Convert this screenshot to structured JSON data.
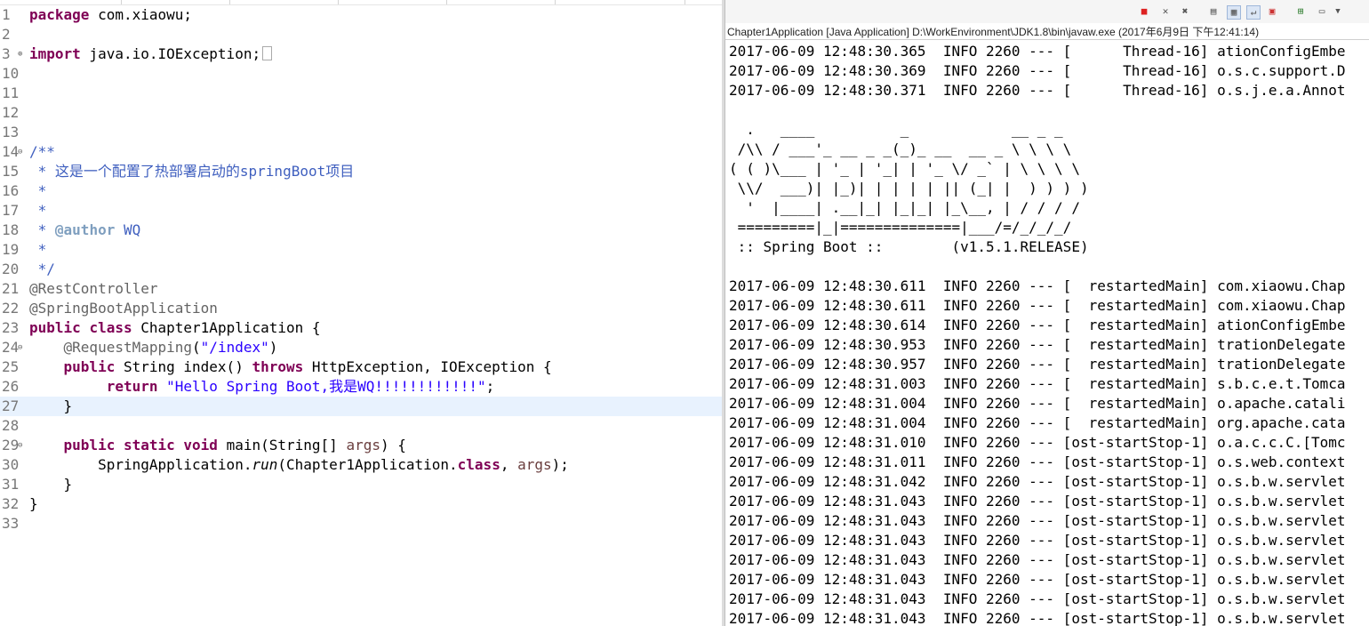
{
  "editor": {
    "lines": [
      {
        "num": "1",
        "parts": [
          {
            "t": "package",
            "c": "kw"
          },
          {
            "t": " com.xiaowu;"
          }
        ]
      },
      {
        "num": "2",
        "parts": []
      },
      {
        "num": "3",
        "fold": "⊕",
        "parts": [
          {
            "t": "import",
            "c": "kw"
          },
          {
            "t": " java.io.IOException;"
          }
        ],
        "box": true
      },
      {
        "num": "10",
        "parts": []
      },
      {
        "num": "11",
        "parts": []
      },
      {
        "num": "12",
        "parts": []
      },
      {
        "num": "13",
        "parts": []
      },
      {
        "num": "14",
        "fold": "⊖",
        "parts": [
          {
            "t": "/**",
            "c": "com"
          }
        ]
      },
      {
        "num": "15",
        "parts": [
          {
            "t": " * 这是一个配置了热部署启动的springBoot项目",
            "c": "com"
          }
        ]
      },
      {
        "num": "16",
        "parts": [
          {
            "t": " *",
            "c": "com"
          }
        ]
      },
      {
        "num": "17",
        "parts": [
          {
            "t": " *",
            "c": "com"
          }
        ]
      },
      {
        "num": "18",
        "parts": [
          {
            "t": " * ",
            "c": "com"
          },
          {
            "t": "@author",
            "c": "tag"
          },
          {
            "t": " WQ",
            "c": "com"
          }
        ]
      },
      {
        "num": "19",
        "parts": [
          {
            "t": " *",
            "c": "com"
          }
        ]
      },
      {
        "num": "20",
        "parts": [
          {
            "t": " */",
            "c": "com"
          }
        ]
      },
      {
        "num": "21",
        "parts": [
          {
            "t": "@RestController",
            "c": "ann"
          }
        ]
      },
      {
        "num": "22",
        "parts": [
          {
            "t": "@SpringBootApplication",
            "c": "ann"
          }
        ]
      },
      {
        "num": "23",
        "parts": [
          {
            "t": "public",
            "c": "kw"
          },
          {
            "t": " "
          },
          {
            "t": "class",
            "c": "kw"
          },
          {
            "t": " Chapter1Application {"
          }
        ]
      },
      {
        "num": "24",
        "fold": "⊖",
        "parts": [
          {
            "t": "    "
          },
          {
            "t": "@RequestMapping",
            "c": "ann"
          },
          {
            "t": "("
          },
          {
            "t": "\"/index\"",
            "c": "str"
          },
          {
            "t": ")"
          }
        ]
      },
      {
        "num": "25",
        "parts": [
          {
            "t": "    "
          },
          {
            "t": "public",
            "c": "kw"
          },
          {
            "t": " String index() "
          },
          {
            "t": "throws",
            "c": "kw"
          },
          {
            "t": " HttpException, IOException {"
          }
        ]
      },
      {
        "num": "26",
        "parts": [
          {
            "t": "         "
          },
          {
            "t": "return",
            "c": "kw"
          },
          {
            "t": " "
          },
          {
            "t": "\"Hello Spring Boot,我是WQ!!!!!!!!!!!!\"",
            "c": "str"
          },
          {
            "t": ";"
          }
        ]
      },
      {
        "num": "27",
        "current": true,
        "parts": [
          {
            "t": "    }"
          }
        ]
      },
      {
        "num": "28",
        "parts": []
      },
      {
        "num": "29",
        "fold": "⊖",
        "parts": [
          {
            "t": "    "
          },
          {
            "t": "public",
            "c": "kw"
          },
          {
            "t": " "
          },
          {
            "t": "static",
            "c": "kw"
          },
          {
            "t": " "
          },
          {
            "t": "void",
            "c": "kw"
          },
          {
            "t": " main(String[] "
          },
          {
            "t": "args",
            "c": "arg"
          },
          {
            "t": ") {"
          }
        ]
      },
      {
        "num": "30",
        "parts": [
          {
            "t": "        SpringApplication."
          },
          {
            "t": "run",
            "c": "it"
          },
          {
            "t": "(Chapter1Application."
          },
          {
            "t": "class",
            "c": "kw"
          },
          {
            "t": ", "
          },
          {
            "t": "args",
            "c": "arg"
          },
          {
            "t": ");"
          }
        ]
      },
      {
        "num": "31",
        "parts": [
          {
            "t": "    }"
          }
        ]
      },
      {
        "num": "32",
        "parts": [
          {
            "t": "}"
          }
        ]
      },
      {
        "num": "33",
        "parts": []
      }
    ]
  },
  "console": {
    "title": "Chapter1Application [Java Application] D:\\WorkEnvironment\\JDK1.8\\bin\\javaw.exe (2017年6月9日 下午12:41:14)",
    "toolbar_icons": [
      "terminate-icon",
      "remove-launch-icon",
      "remove-all-launches-icon",
      "clear-console-icon",
      "scroll-lock-icon",
      "word-wrap-icon",
      "pin-console-icon",
      "new-console-icon",
      "display-selected-console-icon",
      "view-menu-icon"
    ],
    "lines": [
      "2017-06-09 12:48:30.365  INFO 2260 --- [      Thread-16] ationConfigEmbe",
      "2017-06-09 12:48:30.369  INFO 2260 --- [      Thread-16] o.s.c.support.D",
      "2017-06-09 12:48:30.371  INFO 2260 --- [      Thread-16] o.s.j.e.a.Annot",
      "",
      "  .   ____          _            __ _ _",
      " /\\\\ / ___'_ __ _ _(_)_ __  __ _ \\ \\ \\ \\",
      "( ( )\\___ | '_ | '_| | '_ \\/ _` | \\ \\ \\ \\",
      " \\\\/  ___)| |_)| | | | | || (_| |  ) ) ) )",
      "  '  |____| .__|_| |_|_| |_\\__, | / / / /",
      " =========|_|==============|___/=/_/_/_/",
      " :: Spring Boot ::        (v1.5.1.RELEASE)",
      "",
      "2017-06-09 12:48:30.611  INFO 2260 --- [  restartedMain] com.xiaowu.Chap",
      "2017-06-09 12:48:30.611  INFO 2260 --- [  restartedMain] com.xiaowu.Chap",
      "2017-06-09 12:48:30.614  INFO 2260 --- [  restartedMain] ationConfigEmbe",
      "2017-06-09 12:48:30.953  INFO 2260 --- [  restartedMain] trationDelegate",
      "2017-06-09 12:48:30.957  INFO 2260 --- [  restartedMain] trationDelegate",
      "2017-06-09 12:48:31.003  INFO 2260 --- [  restartedMain] s.b.c.e.t.Tomca",
      "2017-06-09 12:48:31.004  INFO 2260 --- [  restartedMain] o.apache.catali",
      "2017-06-09 12:48:31.004  INFO 2260 --- [  restartedMain] org.apache.cata",
      "2017-06-09 12:48:31.010  INFO 2260 --- [ost-startStop-1] o.a.c.c.C.[Tomc",
      "2017-06-09 12:48:31.011  INFO 2260 --- [ost-startStop-1] o.s.web.context",
      "2017-06-09 12:48:31.042  INFO 2260 --- [ost-startStop-1] o.s.b.w.servlet",
      "2017-06-09 12:48:31.043  INFO 2260 --- [ost-startStop-1] o.s.b.w.servlet",
      "2017-06-09 12:48:31.043  INFO 2260 --- [ost-startStop-1] o.s.b.w.servlet",
      "2017-06-09 12:48:31.043  INFO 2260 --- [ost-startStop-1] o.s.b.w.servlet",
      "2017-06-09 12:48:31.043  INFO 2260 --- [ost-startStop-1] o.s.b.w.servlet",
      "2017-06-09 12:48:31.043  INFO 2260 --- [ost-startStop-1] o.s.b.w.servlet",
      "2017-06-09 12:48:31.043  INFO 2260 --- [ost-startStop-1] o.s.b.w.servlet",
      "2017-06-09 12:48:31.043  INFO 2260 --- [ost-startStop-1] o.s.b.w.servlet"
    ]
  }
}
